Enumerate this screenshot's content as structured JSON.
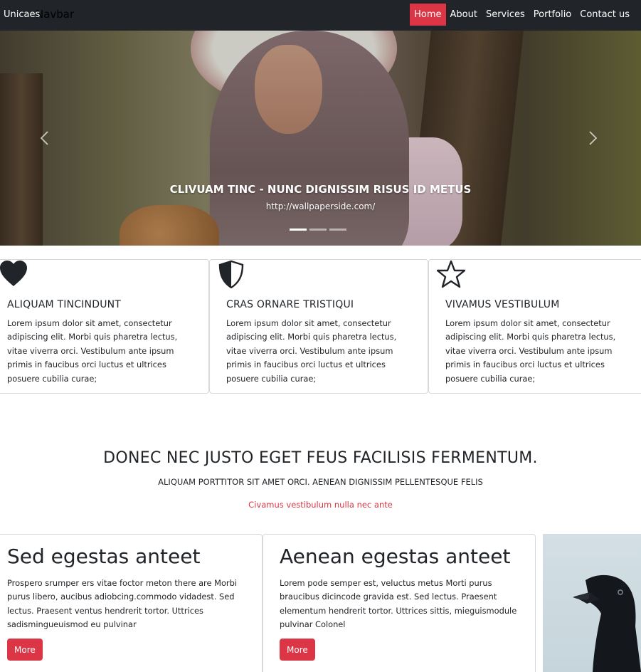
{
  "navbar": {
    "brand": "Unicaes",
    "brand_behind": "Navbar",
    "items": [
      {
        "label": "Home",
        "active": true
      },
      {
        "label": "About"
      },
      {
        "label": "Services"
      },
      {
        "label": "Portfolio"
      },
      {
        "label": "Contact us"
      }
    ],
    "active_color": "#dc3545",
    "background": "#212529"
  },
  "hero": {
    "caption_title": "CLIVUAM TINC - NUNC DIGNISSIM RISUS ID METUS",
    "caption_text": "http://wallpaperside.com/",
    "prev_icon": "chevron-left-icon",
    "next_icon": "chevron-right-icon",
    "slide_count": 3,
    "active_slide": 1
  },
  "features": [
    {
      "icon": "heart-icon",
      "title": "ALIQUAM TINCINDUNT",
      "text": "Lorem ipsum dolor sit amet, consectetur adipiscing elit. Morbi quis pharetra lectus, vitae viverra orci. Vestibulum ante ipsum primis in faucibus orci luctus et ultrices posuere cubilia curae;"
    },
    {
      "icon": "shield-half-icon",
      "title": "CRAS ORNARE TRISTIQUI",
      "text": "Lorem ipsum dolor sit amet, consectetur adipiscing elit. Morbi quis pharetra lectus, vitae viverra orci. Vestibulum ante ipsum primis in faucibus orci luctus et ultrices posuere cubilia curae;"
    },
    {
      "icon": "star-outline-icon",
      "title": "VIVAMUS VESTIBULUM",
      "text": "Lorem ipsum dolor sit amet, consectetur adipiscing elit. Morbi quis pharetra lectus, vitae viverra orci. Vestibulum ante ipsum primis in faucibus orci luctus et ultrices posuere cubilia curae;"
    }
  ],
  "section": {
    "headline": "DONEC NEC JUSTO EGET FEUS FACILISIS FERMENTUM.",
    "subhead": "ALIQUAM PORTTITOR SIT AMET ORCI. AENEAN DIGNISSIM PELLENTESQUE FELIS",
    "accent": "Civamus vestibulum nulla nec ante",
    "accent_color": "#dc3545"
  },
  "cards": [
    {
      "title": "Sed egestas anteet",
      "lines": [
        "Prospero srumper ers vitae foctor meton there are Morbi",
        "purus libero, aucibus adiobcing.commodo vidadest. Sed",
        "lectus. Praesent ventus hendrerit tortor. Uttrices",
        "sadismingueuismod eu pulvinar"
      ],
      "button": "More"
    },
    {
      "title": "Aenean egestas anteet",
      "lines": [
        "Lorem pode semper est, veluctus metus Morti purus",
        "braucibus dicincode gravida est. Sed lectus. Praesent",
        "elementum hendrerit tortor. Uttrices sittis, mieguismodule",
        "pulvinar Colonel"
      ],
      "button": "More"
    }
  ]
}
